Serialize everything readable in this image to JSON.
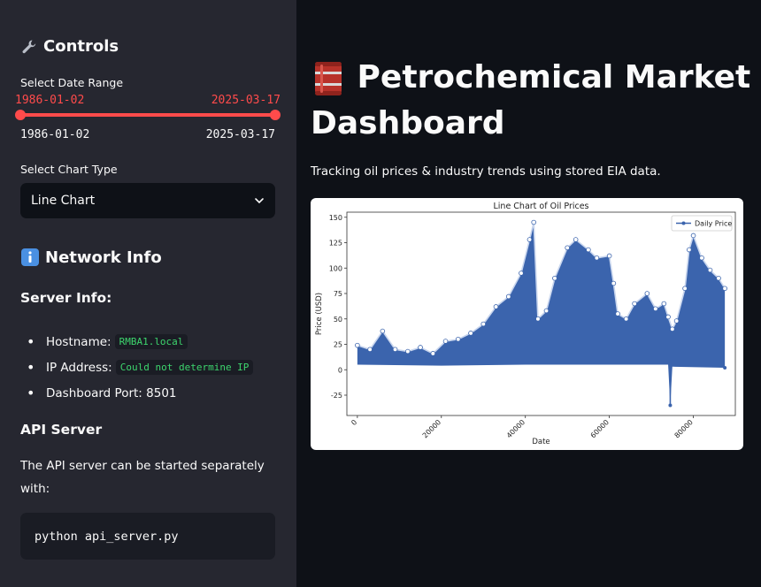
{
  "sidebar": {
    "controls_heading": "Controls",
    "date_range_label": "Select Date Range",
    "date_start": "1986-01-02",
    "date_end": "2025-03-17",
    "date_min": "1986-01-02",
    "date_max": "2025-03-17",
    "chart_type_label": "Select Chart Type",
    "chart_type_value": "Line Chart",
    "network_heading": "Network Info",
    "server_info_heading": "Server Info:",
    "hostname_label": "Hostname:",
    "hostname_value": "RMBA1.local",
    "ip_label": "IP Address:",
    "ip_value": "Could not determine IP",
    "port_text": "Dashboard Port: 8501",
    "api_heading": "API Server",
    "api_text": "The API server can be started separately with:",
    "api_command": "python api_server.py"
  },
  "main": {
    "title": "Petrochemical Market Dashboard",
    "subtitle": "Tracking oil prices & industry trends using stored EIA data."
  },
  "colors": {
    "accent": "#ff4b4b",
    "series": "#3b64ad",
    "code_green": "#3dd56d"
  },
  "icons": [
    "wrench-icon",
    "info-icon",
    "oil-barrel-icon",
    "chevron-down-icon"
  ],
  "chart_data": {
    "type": "line",
    "title": "Line Chart of Oil Prices",
    "xlabel": "Date",
    "ylabel": "Price (USD)",
    "xlim": [
      -2500,
      90000
    ],
    "ylim": [
      -45,
      155
    ],
    "xticks": [
      0,
      20000,
      40000,
      60000,
      80000
    ],
    "yticks": [
      -25,
      0,
      25,
      50,
      75,
      100,
      125,
      150
    ],
    "legend": "top-right",
    "grid": false,
    "series": [
      {
        "name": "Daily Price",
        "upper_envelope": [
          [
            0,
            24
          ],
          [
            3000,
            20
          ],
          [
            6000,
            38
          ],
          [
            9000,
            20
          ],
          [
            12000,
            18
          ],
          [
            15000,
            22
          ],
          [
            18000,
            16
          ],
          [
            21000,
            28
          ],
          [
            24000,
            30
          ],
          [
            27000,
            36
          ],
          [
            30000,
            45
          ],
          [
            33000,
            62
          ],
          [
            36000,
            72
          ],
          [
            39000,
            95
          ],
          [
            41000,
            128
          ],
          [
            42000,
            145
          ],
          [
            43000,
            50
          ],
          [
            45000,
            58
          ],
          [
            47000,
            90
          ],
          [
            50000,
            120
          ],
          [
            52000,
            128
          ],
          [
            55000,
            118
          ],
          [
            57000,
            110
          ],
          [
            60000,
            112
          ],
          [
            61000,
            85
          ],
          [
            62000,
            55
          ],
          [
            64000,
            50
          ],
          [
            66000,
            65
          ],
          [
            69000,
            75
          ],
          [
            71000,
            60
          ],
          [
            73000,
            65
          ],
          [
            74000,
            52
          ],
          [
            75000,
            40
          ],
          [
            76000,
            48
          ],
          [
            78000,
            80
          ],
          [
            79000,
            118
          ],
          [
            80000,
            132
          ],
          [
            82000,
            110
          ],
          [
            84000,
            98
          ],
          [
            86000,
            90
          ],
          [
            87500,
            80
          ]
        ],
        "lower_envelope": [
          [
            0,
            5
          ],
          [
            20000,
            4
          ],
          [
            40000,
            5
          ],
          [
            60000,
            5
          ],
          [
            74000,
            5
          ],
          [
            74500,
            -35
          ],
          [
            75000,
            3
          ],
          [
            87500,
            2
          ]
        ]
      }
    ]
  }
}
